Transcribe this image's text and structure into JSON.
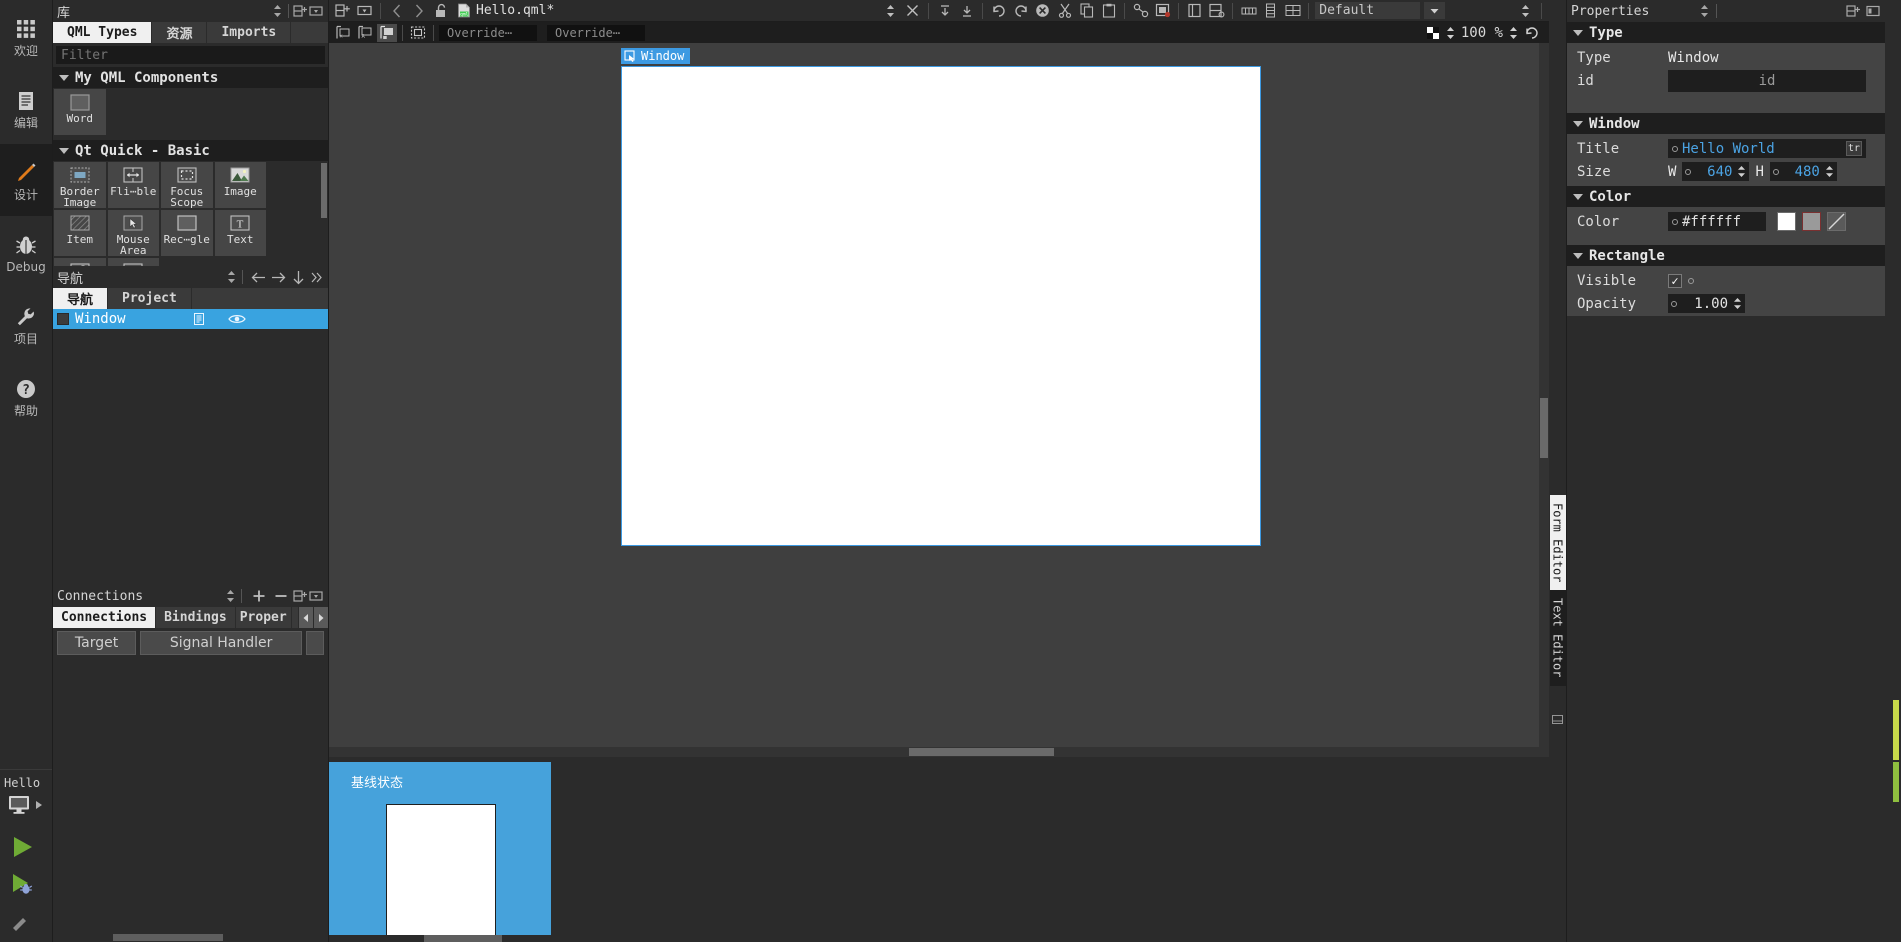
{
  "modebar": {
    "items": [
      {
        "label": "欢迎",
        "icon": "grid-icon",
        "active": false
      },
      {
        "label": "编辑",
        "icon": "document-icon",
        "active": false
      },
      {
        "label": "设计",
        "icon": "pencil-icon",
        "active": true
      },
      {
        "label": "Debug",
        "icon": "bug-icon",
        "active": false
      },
      {
        "label": "项目",
        "icon": "wrench-icon",
        "active": false
      },
      {
        "label": "帮助",
        "icon": "question-icon",
        "active": false
      }
    ],
    "kit": {
      "name": "Hello",
      "target_icon": "desktop-icon",
      "expand_arrow": "▶"
    },
    "run_label": "run-button",
    "debug_label": "debug-button"
  },
  "library": {
    "header_title": "库",
    "tabs": [
      {
        "label": "QML Types",
        "active": true
      },
      {
        "label": "资源",
        "active": false
      },
      {
        "label": "Imports",
        "active": false
      }
    ],
    "filter_placeholder": "Filter",
    "filter_value": "",
    "sections": [
      {
        "title": "My QML Components",
        "items": [
          {
            "name": "Word",
            "icon": "rectangle-icon"
          }
        ]
      },
      {
        "title": "Qt Quick - Basic",
        "items": [
          {
            "name": "Border Image",
            "icon": "border-image-icon"
          },
          {
            "name": "Fli⋯ble",
            "icon": "flickable-icon"
          },
          {
            "name": "Focus Scope",
            "icon": "focus-scope-icon"
          },
          {
            "name": "Image",
            "icon": "image-icon"
          },
          {
            "name": "Item",
            "icon": "item-icon"
          },
          {
            "name": "Mouse Area",
            "icon": "mouse-area-icon"
          },
          {
            "name": "Rec⋯gle",
            "icon": "rectangle-icon"
          },
          {
            "name": "Text",
            "icon": "text-icon"
          },
          {
            "name": "",
            "icon": "text-input-icon"
          },
          {
            "name": "",
            "icon": "text-edit-icon"
          }
        ]
      }
    ]
  },
  "navigator": {
    "header_title": "导航",
    "toolbar_icons": [
      "arrow-left-icon",
      "arrow-right-icon",
      "arrow-down-icon",
      "chevron-double-right-icon"
    ],
    "tabs": [
      {
        "label": "导航",
        "active": true
      },
      {
        "label": "Project",
        "active": false
      }
    ],
    "rows": [
      {
        "label": "Window",
        "export_icon": "export-icon",
        "visibility_icon": "eye-icon",
        "selected": true
      }
    ]
  },
  "connections": {
    "header_title": "Connections",
    "toolbar_icons": [
      "plus-icon",
      "minus-icon",
      "split-icon",
      "dropdown-icon"
    ],
    "tabs": [
      {
        "label": "Connections",
        "active": true
      },
      {
        "label": "Bindings",
        "active": false
      },
      {
        "label": "Proper",
        "active": false
      }
    ],
    "columns": [
      "Target",
      "Signal Handler",
      ""
    ]
  },
  "toolbar": {
    "left_icons": [
      "split-add-icon",
      "dropdown-icon",
      "back-icon",
      "forward-icon",
      "unlock-icon"
    ],
    "file_icon": "qml-file-icon",
    "file_name": "Hello.qml*",
    "right_icons": [
      "file-combo-spin",
      "close-icon",
      "collapse-all-icon",
      "expand-all-icon",
      "undo-icon",
      "redo-icon",
      "stop-icon",
      "cut-icon",
      "copy-icon",
      "paste-icon",
      "build-icon",
      "debug-breakpoint-icon",
      "split-editor-icon",
      "split-editor-side-icon"
    ],
    "view_icons": [
      "columns-icon",
      "rows-icon",
      "grid-icon"
    ],
    "preset_label": "Default",
    "preset_caret": "▼"
  },
  "designbar": {
    "buttons": [
      {
        "icon": "no-snapping-icon",
        "active": false
      },
      {
        "icon": "snap-anchors-icon",
        "active": false
      },
      {
        "icon": "snap-items-icon",
        "active": true
      },
      {
        "icon": "select-only-items-icon",
        "active": false
      }
    ],
    "override_width": "Override⋯",
    "override_height": "Override⋯",
    "zoom_out_icon": "zoom-spinner-icon",
    "zoom_value": "100 %",
    "reset_icon": "reset-view-icon"
  },
  "canvas": {
    "selection_label": "Window",
    "selection_icon": "component-icon",
    "form_width": 640,
    "form_height": 480,
    "form_color": "#ffffff",
    "accent": "#3d9ae2"
  },
  "states": {
    "card_title": "基线状态",
    "card_color": "#46a2db"
  },
  "vtabs": [
    {
      "label": "Form Editor",
      "active": true
    },
    {
      "label": "Text Editor",
      "active": false
    }
  ],
  "properties": {
    "header_title": "Properties",
    "header_icons": [
      "split-add-icon",
      "dropdown-icon"
    ],
    "sections": [
      {
        "title": "Type",
        "rows": [
          {
            "kind": "static",
            "label": "Type",
            "value": "Window"
          },
          {
            "kind": "id",
            "label": "id",
            "value": "",
            "placeholder": "id"
          }
        ]
      },
      {
        "title": "Window",
        "rows": [
          {
            "kind": "text",
            "label": "Title",
            "value": "Hello World",
            "badge": "tr"
          },
          {
            "kind": "size",
            "label": "Size",
            "w_label": "W",
            "w_value": "640",
            "h_label": "H",
            "h_value": "480"
          }
        ]
      },
      {
        "title": "Color",
        "rows": [
          {
            "kind": "color",
            "label": "Color",
            "value": "#ffffff",
            "swatch1": "#ffffff",
            "swatch2": "#9a9a9a",
            "swatch3": "transparent"
          }
        ]
      },
      {
        "title": "Rectangle",
        "rows": [
          {
            "kind": "check",
            "label": "Visible",
            "checked": true
          },
          {
            "kind": "number",
            "label": "Opacity",
            "value": "1.00"
          }
        ]
      }
    ]
  }
}
